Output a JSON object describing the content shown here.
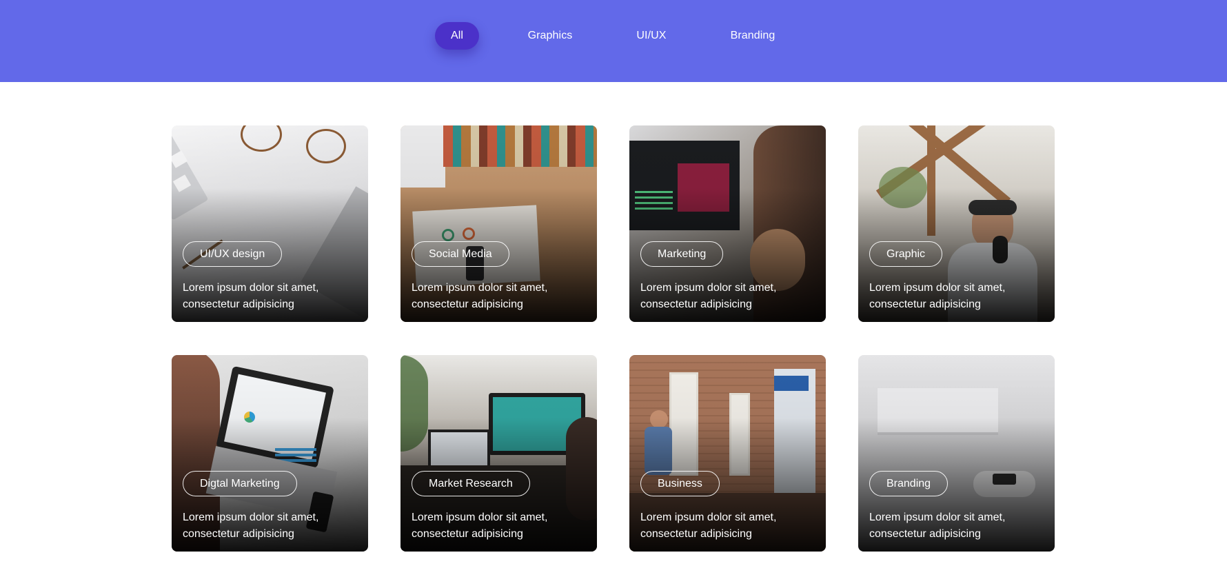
{
  "filters": {
    "items": [
      {
        "label": "All",
        "active": true
      },
      {
        "label": "Graphics",
        "active": false
      },
      {
        "label": "UI/UX",
        "active": false
      },
      {
        "label": "Branding",
        "active": false
      }
    ]
  },
  "colors": {
    "header_bg": "#6269e9",
    "active_pill": "#4b31c9",
    "page_bg": "#ffffff",
    "card_text": "#ffffff"
  },
  "cards": [
    {
      "tag": "UI/UX design",
      "text": "Lorem ipsum dolor sit amet, consectetur adipisicing",
      "image": "desk-glasses-keyboard-photo"
    },
    {
      "tag": "Social Media",
      "text": "Lorem ipsum dolor sit amet, consectetur adipisicing",
      "image": "bookshelf-notebook-photo"
    },
    {
      "tag": "Marketing",
      "text": "Lorem ipsum dolor sit amet, consectetur adipisicing",
      "image": "monitor-website-photo"
    },
    {
      "tag": "Graphic",
      "text": "Lorem ipsum dolor sit amet, consectetur adipisicing",
      "image": "podcast-studio-photo"
    },
    {
      "tag": "Digtal Marketing",
      "text": "Lorem ipsum dolor sit amet, consectetur adipisicing",
      "image": "laptop-analytics-photo"
    },
    {
      "tag": "Market Research",
      "text": "Lorem ipsum dolor sit amet, consectetur adipisicing",
      "image": "meeting-screens-photo"
    },
    {
      "tag": "Business",
      "text": "Lorem ipsum dolor sit amet, consectetur adipisicing",
      "image": "office-presentation-photo"
    },
    {
      "tag": "Branding",
      "text": "Lorem ipsum dolor sit amet, consectetur adipisicing",
      "image": "console-controller-photo"
    }
  ]
}
